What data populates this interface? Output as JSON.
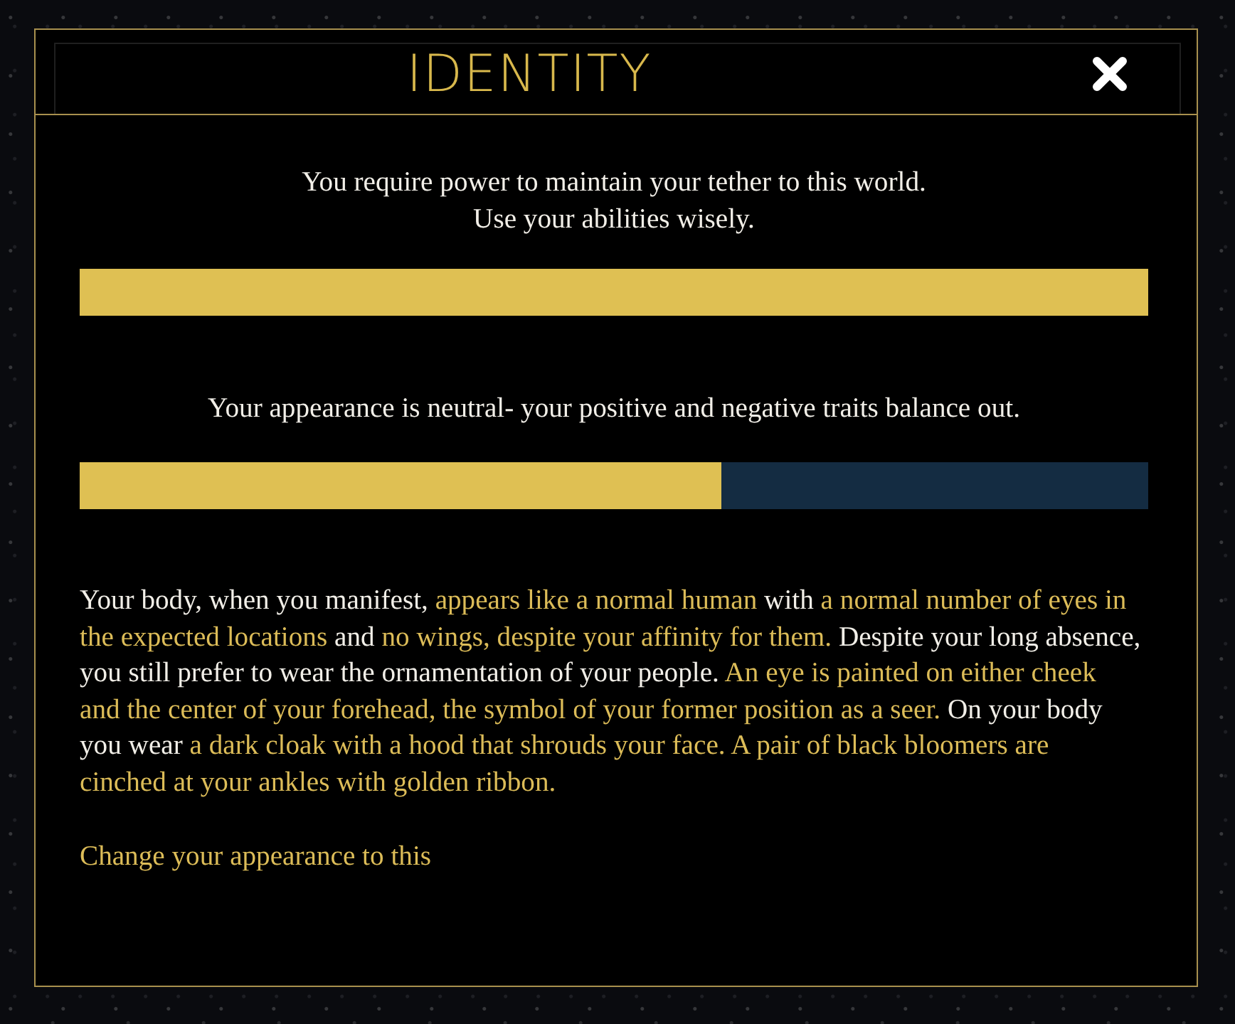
{
  "window": {
    "title": "IDENTITY"
  },
  "power": {
    "lines": [
      "You require power to maintain your tether to this world.",
      "Use your abilities wisely."
    ],
    "level": 1
  },
  "appearance": {
    "message": "Your appearance is neutral- your positive and negative traits balance out.",
    "level": 0.6
  },
  "description": {
    "segments": [
      {
        "text": "Your body, when you manifest, ",
        "highlighted": false
      },
      {
        "text": "appears like a normal human",
        "highlighted": true
      },
      {
        "text": " with ",
        "highlighted": false
      },
      {
        "text": "a normal number of eyes in the expected locations",
        "highlighted": true
      },
      {
        "text": " and ",
        "highlighted": false
      },
      {
        "text": "no wings, despite your affinity for them.",
        "highlighted": true
      },
      {
        "text": " Despite your long absence, you still prefer to wear the ornamentation of your people. ",
        "highlighted": false
      },
      {
        "text": "An eye is painted on either cheek and the center of your forehead, the symbol of your former position as a seer.",
        "highlighted": true
      },
      {
        "text": " On your body you wear ",
        "highlighted": false
      },
      {
        "text": "a dark cloak with a hood that shrouds your face. A pair of black bloomers are cinched at your ankles with golden ribbon.",
        "highlighted": true
      }
    ]
  },
  "change_link": "Change your appearance to this"
}
